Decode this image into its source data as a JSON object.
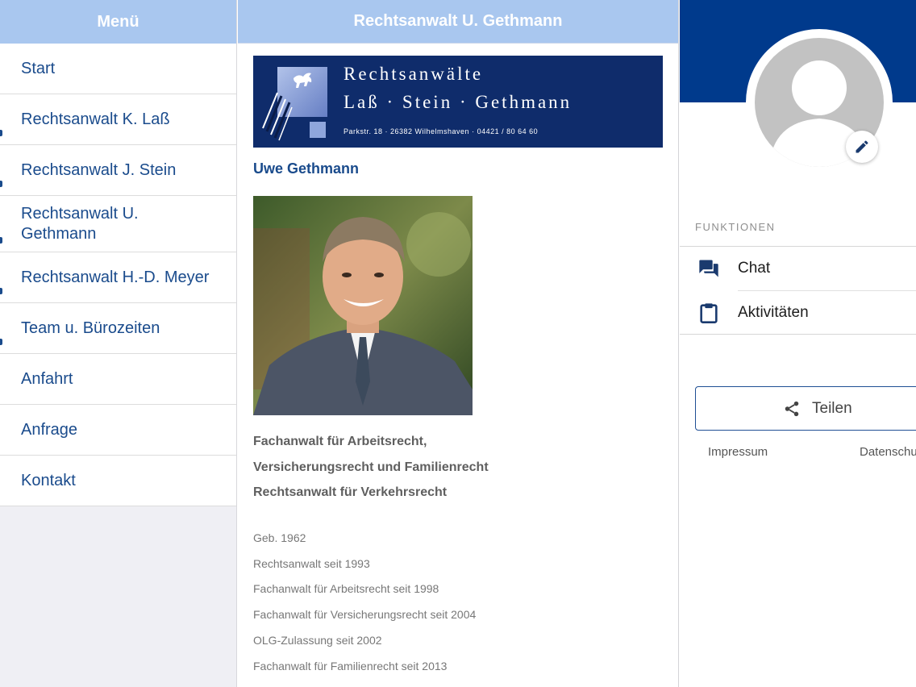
{
  "menu": {
    "title": "Menü",
    "items": [
      {
        "label": "Start"
      },
      {
        "label": "Rechtsanwalt K. Laß"
      },
      {
        "label": "Rechtsanwalt J. Stein"
      },
      {
        "label": "Rechtsanwalt U. Gethmann"
      },
      {
        "label": "Rechtsanwalt H.-D. Meyer"
      },
      {
        "label": "Team u. Bürozeiten"
      },
      {
        "label": "Anfahrt"
      },
      {
        "label": "Anfrage"
      },
      {
        "label": "Kontakt"
      }
    ]
  },
  "content": {
    "title": "Rechtsanwalt U. Gethmann",
    "banner": {
      "line1": "Rechtsanwälte",
      "line2": "Laß · Stein · Gethmann",
      "address": "Parkstr. 18 · 26382 Wilhelmshaven · 04421 / 80 64 60"
    },
    "name": "Uwe Gethmann",
    "qualifications": [
      "Fachanwalt für Arbeitsrecht,",
      "Versicherungsrecht und Familienrecht",
      "Rechtsanwalt für Verkehrsrecht"
    ],
    "facts": [
      "Geb. 1962",
      "Rechtsanwalt seit 1993",
      "Fachanwalt für Arbeitsrecht seit 1998",
      "Fachanwalt für Versicherungsrecht seit 2004",
      "OLG-Zulassung seit 2002",
      "Fachanwalt für Familienrecht seit 2013"
    ]
  },
  "side": {
    "functions_label": "FUNKTIONEN",
    "functions": [
      {
        "label": "Chat",
        "icon": "chat-icon"
      },
      {
        "label": "Aktivitäten",
        "icon": "clipboard-icon"
      }
    ],
    "share_label": "Teilen",
    "footer": {
      "impressum": "Impressum",
      "privacy": "Datenschu"
    }
  },
  "colors": {
    "header_bg": "#a9c7ef",
    "brand_blue": "#003a8c",
    "link_blue": "#1a4b8c",
    "banner_navy": "#0f2c6b"
  }
}
